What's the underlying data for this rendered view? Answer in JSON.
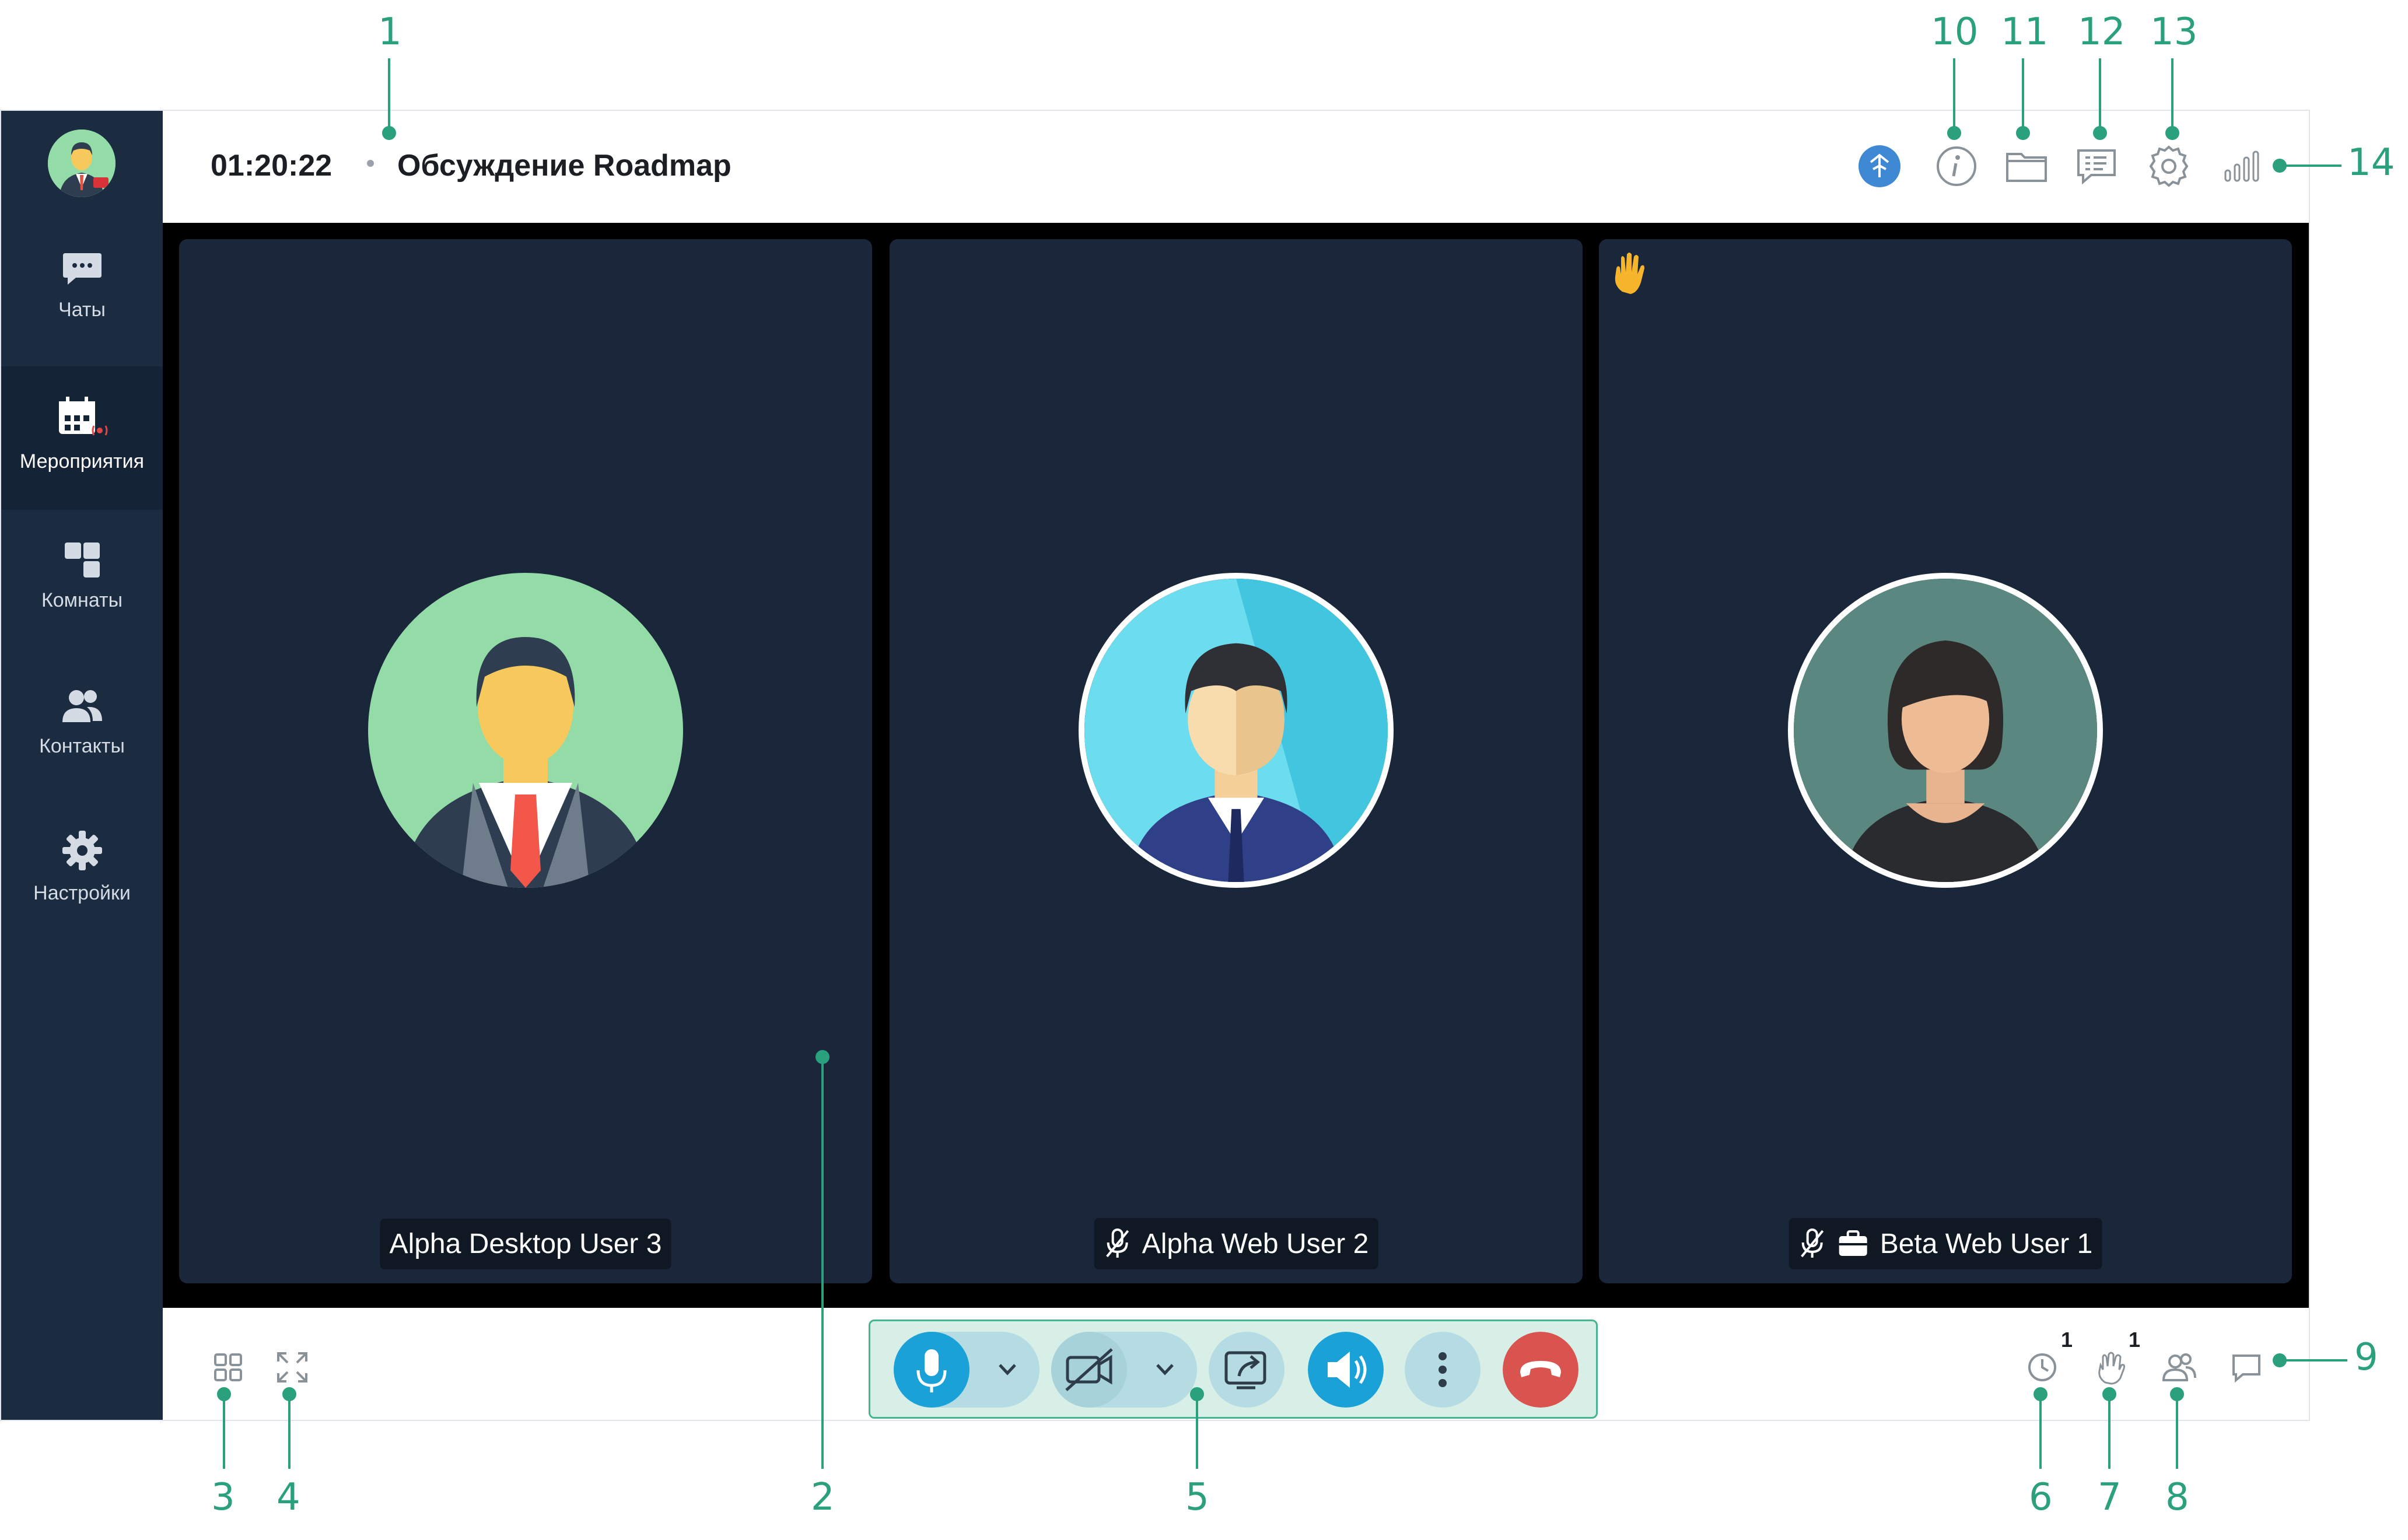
{
  "sidebar": {
    "items": [
      {
        "label": "Чаты",
        "icon": "chat-icon"
      },
      {
        "label": "Мероприятия",
        "icon": "calendar-icon"
      },
      {
        "label": "Комнаты",
        "icon": "rooms-icon"
      },
      {
        "label": "Контакты",
        "icon": "contacts-icon"
      },
      {
        "label": "Настройки",
        "icon": "gear-icon"
      }
    ]
  },
  "header": {
    "timer": "01:20:22",
    "title": "Обсуждение Roadmap"
  },
  "participants": [
    {
      "name": "Alpha Desktop User 3"
    },
    {
      "name": "Alpha Web User 2"
    },
    {
      "name": "Beta Web User 1"
    }
  ],
  "counters": {
    "queue": "1",
    "raised_hands": "1"
  },
  "callouts": [
    "1",
    "2",
    "3",
    "4",
    "5",
    "6",
    "7",
    "8",
    "9",
    "10",
    "11",
    "12",
    "13",
    "14"
  ],
  "colors": {
    "accent": "#2aa07d",
    "sidebar": "#1b2b40",
    "tile": "#1a2639",
    "mic": "#1aa2d8",
    "hangup": "#d9534f"
  }
}
